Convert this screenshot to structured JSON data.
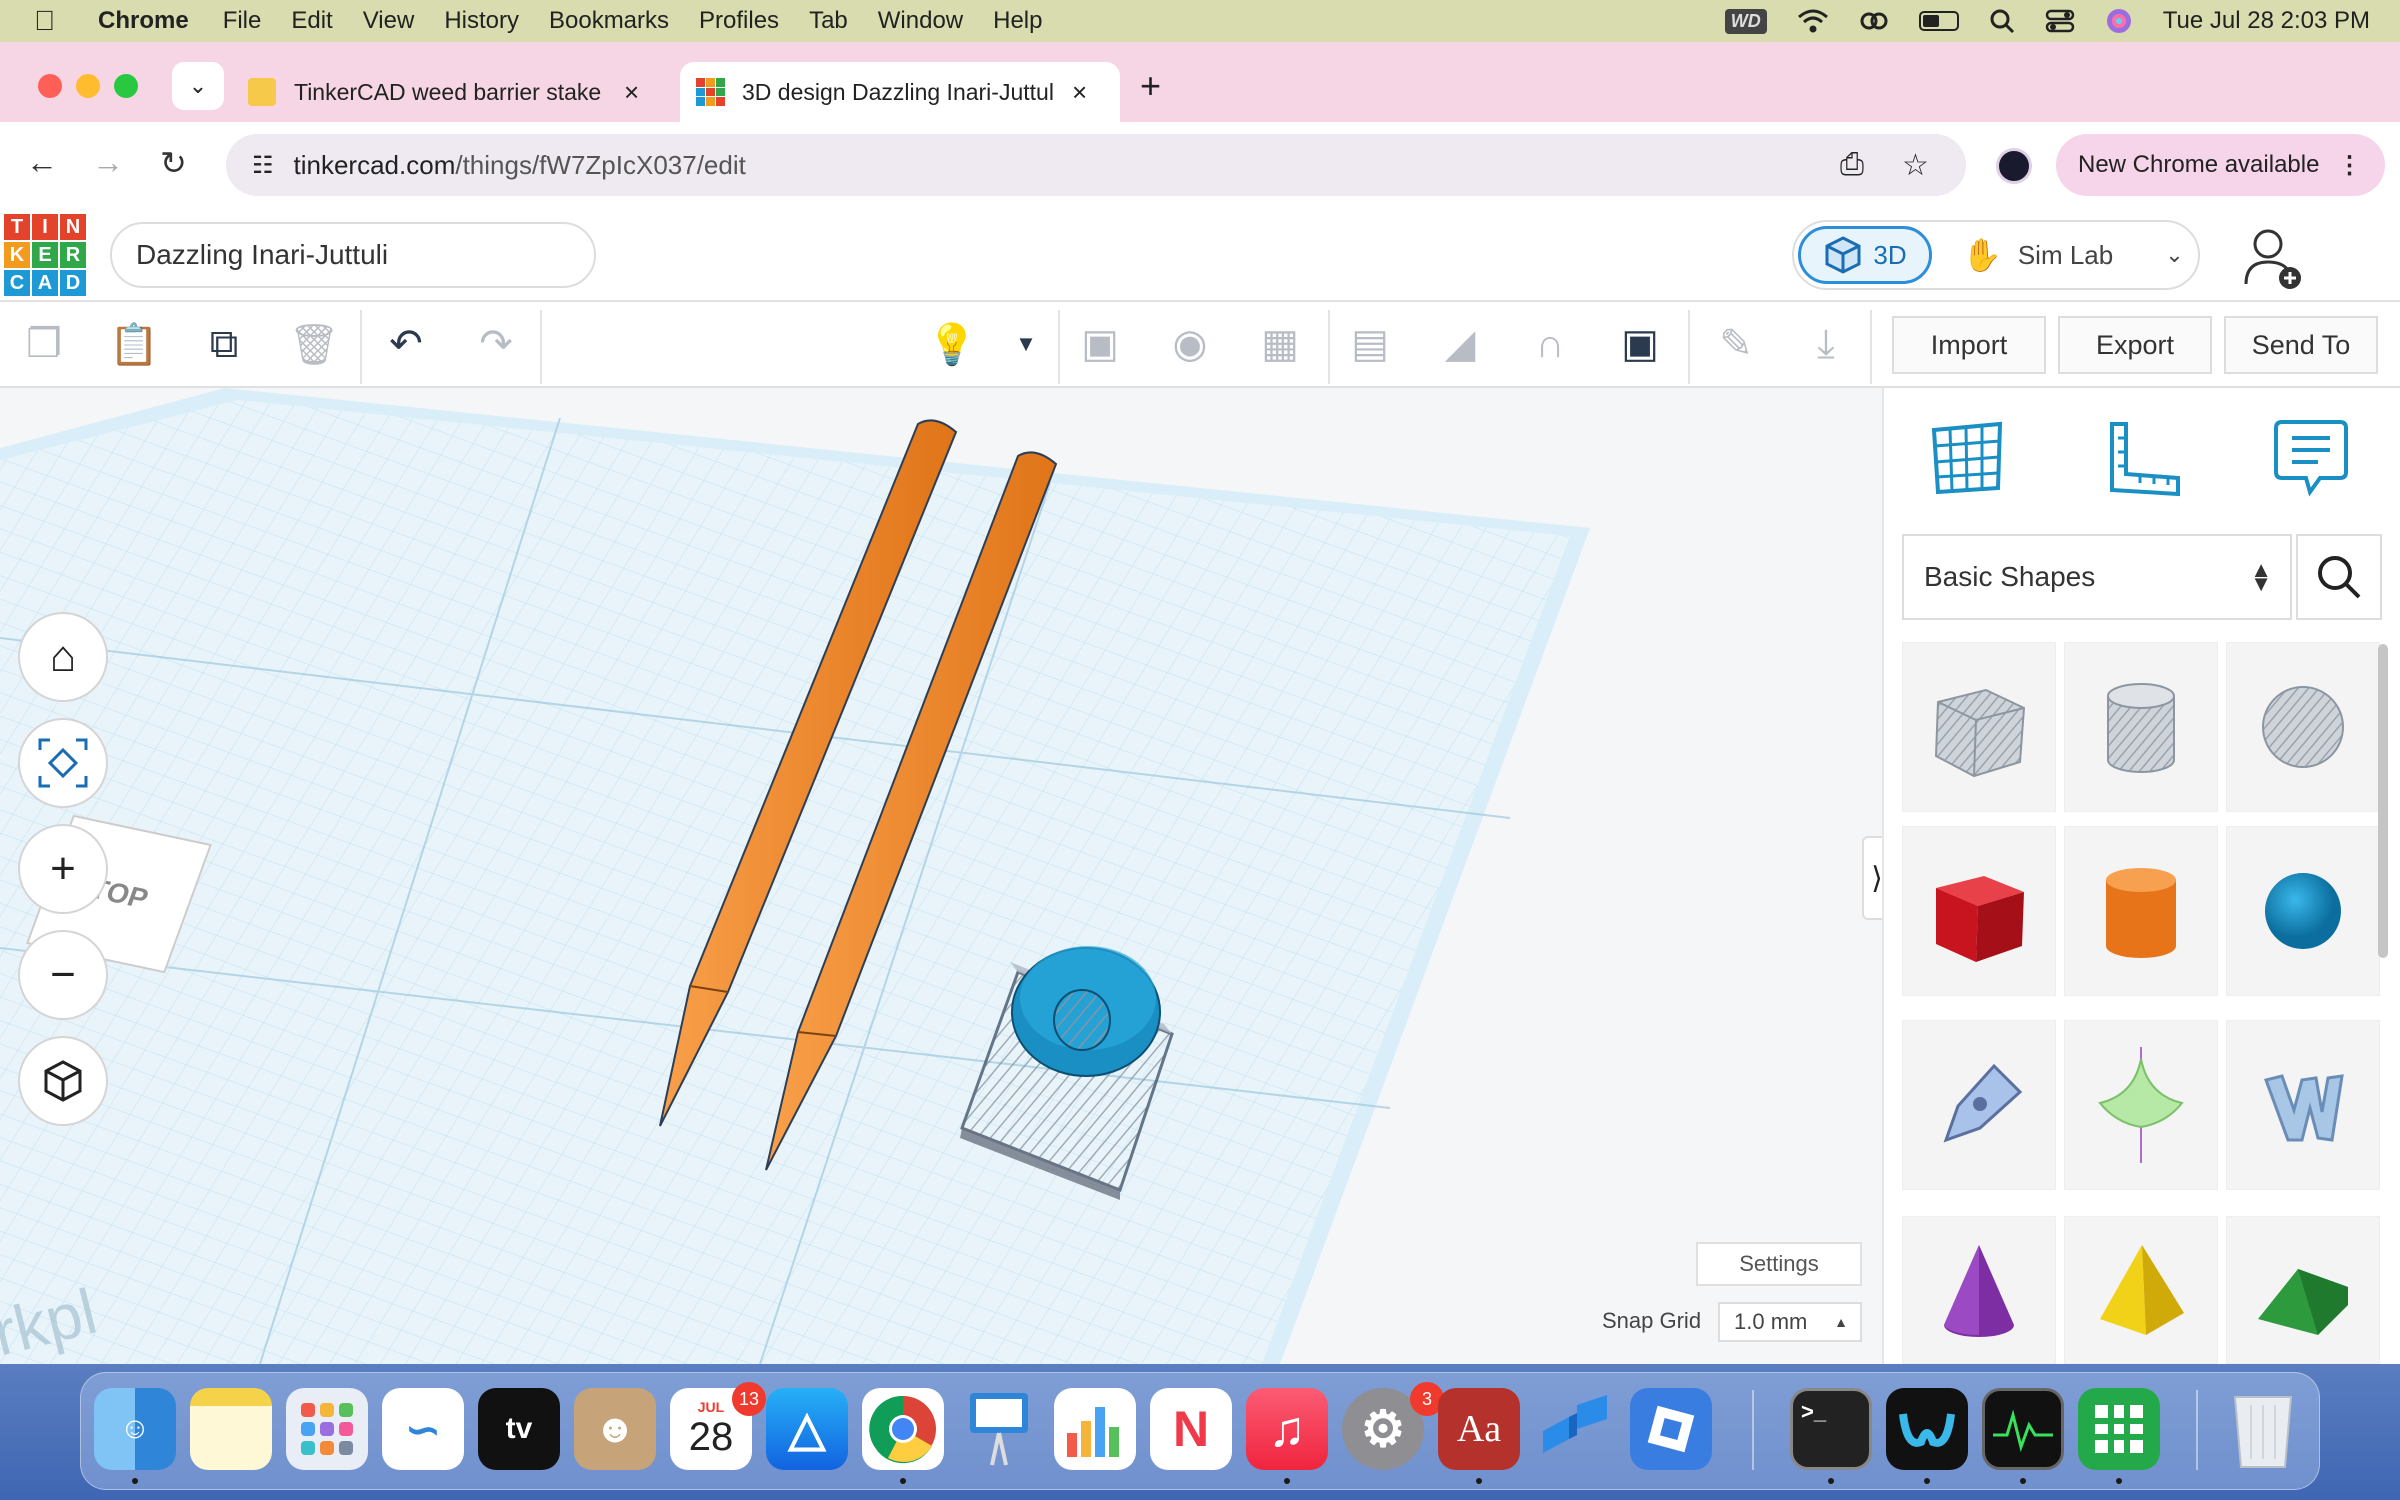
{
  "menubar": {
    "app": "Chrome",
    "items": [
      "File",
      "Edit",
      "View",
      "History",
      "Bookmarks",
      "Profiles",
      "Tab",
      "Window",
      "Help"
    ],
    "wd_label": "WD",
    "datetime": "Tue Jul 28  2:03 PM"
  },
  "tabs": [
    {
      "title": "TinkerCAD weed barrier stake",
      "active": false
    },
    {
      "title": "3D design Dazzling Inari-Juttuli",
      "active": true
    }
  ],
  "address": {
    "domain": "tinkercad.com",
    "path": "/things/fW7ZpIcX037/edit",
    "update_button": "New Chrome available"
  },
  "tinkercad": {
    "logo_letters": [
      "T",
      "I",
      "N",
      "K",
      "E",
      "R",
      "C",
      "A",
      "D"
    ],
    "design_name": "Dazzling Inari-Juttuli",
    "mode_3d": "3D",
    "mode_simlab": "Sim Lab",
    "toolbar_buttons": {
      "import": "Import",
      "export": "Export",
      "send_to": "Send To"
    },
    "viewcube_label": "TOP",
    "settings": "Settings",
    "snap_grid_label": "Snap Grid",
    "snap_grid_value": "1.0 mm",
    "shape_category": "Basic Shapes",
    "shapes": [
      "Box",
      "Cylinder",
      "Sphere",
      "Box",
      "Cylinder",
      "Sphere",
      "Scribble",
      "Spinner",
      "Text",
      "Cone",
      "Pyramid",
      "Roof"
    ],
    "workplane_text": "rkpl"
  },
  "dock": {
    "calendar_month": "JUL",
    "calendar_day": "28",
    "calendar_badge": "13",
    "settings_badge": "3",
    "dictionary_label": "Aa",
    "tv_label": "tv",
    "terminal_label": ">_"
  },
  "colors": {
    "menubar": "#d9dcae",
    "tabstrip": "#f6d6e4",
    "accent_blue": "#2d8ed9",
    "stake_orange": "#f08024",
    "ring_blue": "#1a8fc4"
  }
}
